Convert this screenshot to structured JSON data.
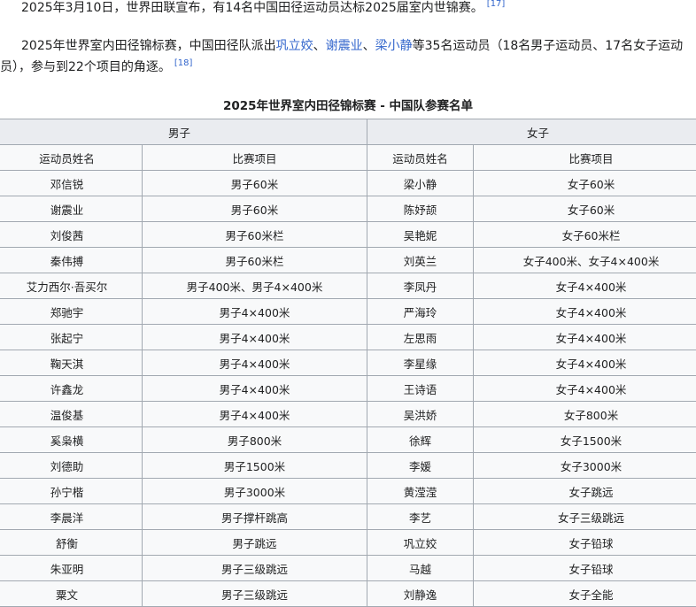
{
  "intro": {
    "p1_text": "2025年3月10日，世界田联宣布，有14名中国田径运动员达标2025届室内世锦赛。",
    "p1_ref": "[17]",
    "p2_text_a": "2025年世界室内田径锦标赛，中国田径队派出",
    "p2_link_1": "巩立姣",
    "p2_sep_1": "、",
    "p2_link_2": "谢震业",
    "p2_sep_2": "、",
    "p2_link_3": "梁小静",
    "p2_text_b": "等35名运动员（18名男子运动员、17名女子运动",
    "p2_text_c": "员），参与到22个项目的角逐。",
    "p2_ref": "[18]"
  },
  "table": {
    "caption": "2025年世界室内田径锦标赛 - 中国队参赛名单",
    "men_header": "男子",
    "women_header": "女子",
    "col_name": "运动员姓名",
    "col_event": "比赛项目",
    "rows": [
      {
        "m_name": "邓信锐",
        "m_event": "男子60米",
        "w_name": "梁小静",
        "w_event": "女子60米"
      },
      {
        "m_name": "谢震业",
        "m_event": "男子60米",
        "w_name": "陈妤颉",
        "w_event": "女子60米"
      },
      {
        "m_name": "刘俊茜",
        "m_event": "男子60米栏",
        "w_name": "吴艳妮",
        "w_event": "女子60米栏"
      },
      {
        "m_name": "秦伟搏",
        "m_event": "男子60米栏",
        "w_name": "刘英兰",
        "w_event": "女子400米、女子4×400米"
      },
      {
        "m_name": "艾力西尔·吾买尔",
        "m_event": "男子400米、男子4×400米",
        "w_name": "李凤丹",
        "w_event": "女子4×400米"
      },
      {
        "m_name": "郑驰宇",
        "m_event": "男子4×400米",
        "w_name": "严海玲",
        "w_event": "女子4×400米"
      },
      {
        "m_name": "张起宁",
        "m_event": "男子4×400米",
        "w_name": "左思雨",
        "w_event": "女子4×400米"
      },
      {
        "m_name": "鞠天淇",
        "m_event": "男子4×400米",
        "w_name": "李星缘",
        "w_event": "女子4×400米"
      },
      {
        "m_name": "许鑫龙",
        "m_event": "男子4×400米",
        "w_name": "王诗语",
        "w_event": "女子4×400米"
      },
      {
        "m_name": "温俊基",
        "m_event": "男子4×400米",
        "w_name": "吴洪娇",
        "w_event": "女子800米"
      },
      {
        "m_name": "奚枭横",
        "m_event": "男子800米",
        "w_name": "徐辉",
        "w_event": "女子1500米"
      },
      {
        "m_name": "刘德助",
        "m_event": "男子1500米",
        "w_name": "李媛",
        "w_event": "女子3000米"
      },
      {
        "m_name": "孙宁楷",
        "m_event": "男子3000米",
        "w_name": "黄滢滢",
        "w_event": "女子跳远"
      },
      {
        "m_name": "李晨洋",
        "m_event": "男子撑杆跳高",
        "w_name": "李艺",
        "w_event": "女子三级跳远"
      },
      {
        "m_name": "舒衡",
        "m_event": "男子跳远",
        "w_name": "巩立姣",
        "w_event": "女子铅球"
      },
      {
        "m_name": "朱亚明",
        "m_event": "男子三级跳远",
        "w_name": "马越",
        "w_event": "女子铅球"
      },
      {
        "m_name": "粟文",
        "m_event": "男子三级跳远",
        "w_name": "刘静逸",
        "w_event": "女子全能"
      }
    ]
  }
}
